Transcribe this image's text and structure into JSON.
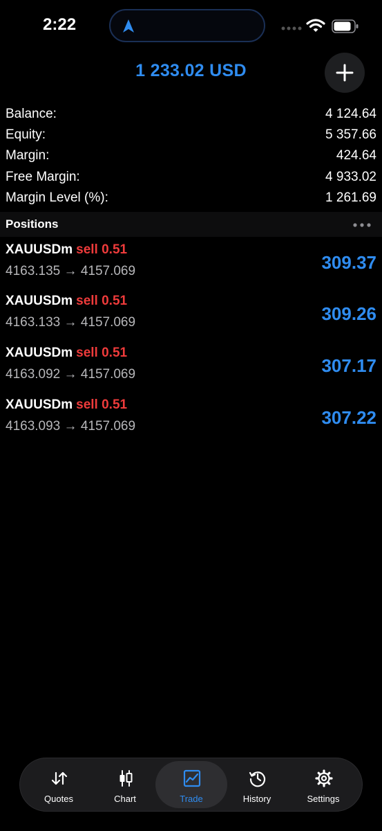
{
  "status_bar": {
    "time": "2:22"
  },
  "header": {
    "total": "1 233.02 USD"
  },
  "summary": [
    {
      "label": "Balance:",
      "value": "4 124.64"
    },
    {
      "label": "Equity:",
      "value": "5 357.66"
    },
    {
      "label": "Margin:",
      "value": "424.64"
    },
    {
      "label": "Free Margin:",
      "value": "4 933.02"
    },
    {
      "label": "Margin Level (%):",
      "value": "1 261.69"
    }
  ],
  "positions": {
    "title": "Positions",
    "items": [
      {
        "symbol": "XAUUSDm",
        "side": "sell 0.51",
        "open": "4163.135",
        "arrow": "→",
        "current": "4157.069",
        "profit": "309.37"
      },
      {
        "symbol": "XAUUSDm",
        "side": "sell 0.51",
        "open": "4163.133",
        "arrow": "→",
        "current": "4157.069",
        "profit": "309.26"
      },
      {
        "symbol": "XAUUSDm",
        "side": "sell 0.51",
        "open": "4163.092",
        "arrow": "→",
        "current": "4157.069",
        "profit": "307.17"
      },
      {
        "symbol": "XAUUSDm",
        "side": "sell 0.51",
        "open": "4163.093",
        "arrow": "→",
        "current": "4157.069",
        "profit": "307.22"
      }
    ]
  },
  "tabs": [
    {
      "label": "Quotes",
      "icon": "quotes-icon",
      "active": false
    },
    {
      "label": "Chart",
      "icon": "chart-icon",
      "active": false
    },
    {
      "label": "Trade",
      "icon": "trade-icon",
      "active": true
    },
    {
      "label": "History",
      "icon": "history-icon",
      "active": false
    },
    {
      "label": "Settings",
      "icon": "settings-icon",
      "active": false
    }
  ],
  "colors": {
    "accent": "#2f8cf0",
    "sell": "#ef3b3b",
    "background": "#000000"
  }
}
